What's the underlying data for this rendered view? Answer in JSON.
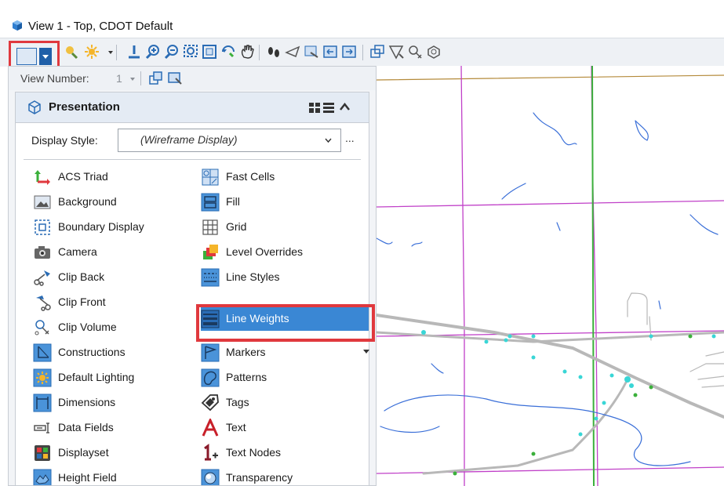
{
  "window": {
    "title": "View 1 - Top, CDOT Default"
  },
  "colors": {
    "accent": "#3a87d4",
    "highlight": "#e0393e",
    "map_purple": "#c040c8",
    "map_green": "#3bb03b",
    "map_blue": "#3a6fd8",
    "map_cyan": "#39d6d6"
  },
  "toolbar": {
    "icons": [
      "view-display-properties-icon",
      "view-attributes-icon",
      "lighting-icon",
      "update-view-icon",
      "zoom-in-icon",
      "zoom-out-icon",
      "window-area-icon",
      "fit-view-icon",
      "rotate-view-icon",
      "pan-view-icon",
      "walk-icon",
      "view-previous-icon",
      "view-next-icon",
      "copy-view-icon",
      "clip-volume-icon",
      "camera-icon",
      "change-view-perspective-icon"
    ]
  },
  "view_number": {
    "label": "View Number:",
    "value": "1"
  },
  "presentation": {
    "title": "Presentation",
    "display_style_label": "Display Style:",
    "display_style_value": "(Wireframe Display)",
    "more": "...",
    "left_items": [
      {
        "label": "ACS Triad",
        "icon": "acs-triad-icon"
      },
      {
        "label": "Background",
        "icon": "background-icon"
      },
      {
        "label": "Boundary Display",
        "icon": "boundary-display-icon"
      },
      {
        "label": "Camera",
        "icon": "camera-icon"
      },
      {
        "label": "Clip Back",
        "icon": "clip-back-icon"
      },
      {
        "label": "Clip Front",
        "icon": "clip-front-icon"
      },
      {
        "label": "Clip Volume",
        "icon": "clip-volume-icon"
      },
      {
        "label": "Constructions",
        "icon": "constructions-icon"
      },
      {
        "label": "Default Lighting",
        "icon": "default-lighting-icon"
      },
      {
        "label": "Dimensions",
        "icon": "dimensions-icon"
      },
      {
        "label": "Data Fields",
        "icon": "data-fields-icon"
      },
      {
        "label": "Displayset",
        "icon": "displayset-icon"
      },
      {
        "label": "Height Field",
        "icon": "height-field-icon"
      }
    ],
    "right_items": [
      {
        "label": "Fast Cells",
        "icon": "fast-cells-icon"
      },
      {
        "label": "Fill",
        "icon": "fill-icon"
      },
      {
        "label": "Grid",
        "icon": "grid-icon"
      },
      {
        "label": "Level Overrides",
        "icon": "level-overrides-icon"
      },
      {
        "label": "Line Styles",
        "icon": "line-styles-icon"
      },
      {
        "label": "Line Weights",
        "icon": "line-weights-icon",
        "selected": true
      },
      {
        "label": "Markers",
        "icon": "markers-icon"
      },
      {
        "label": "Patterns",
        "icon": "patterns-icon"
      },
      {
        "label": "Tags",
        "icon": "tags-icon"
      },
      {
        "label": "Text",
        "icon": "text-icon"
      },
      {
        "label": "Text Nodes",
        "icon": "text-nodes-icon"
      },
      {
        "label": "Transparency",
        "icon": "transparency-icon"
      }
    ]
  }
}
